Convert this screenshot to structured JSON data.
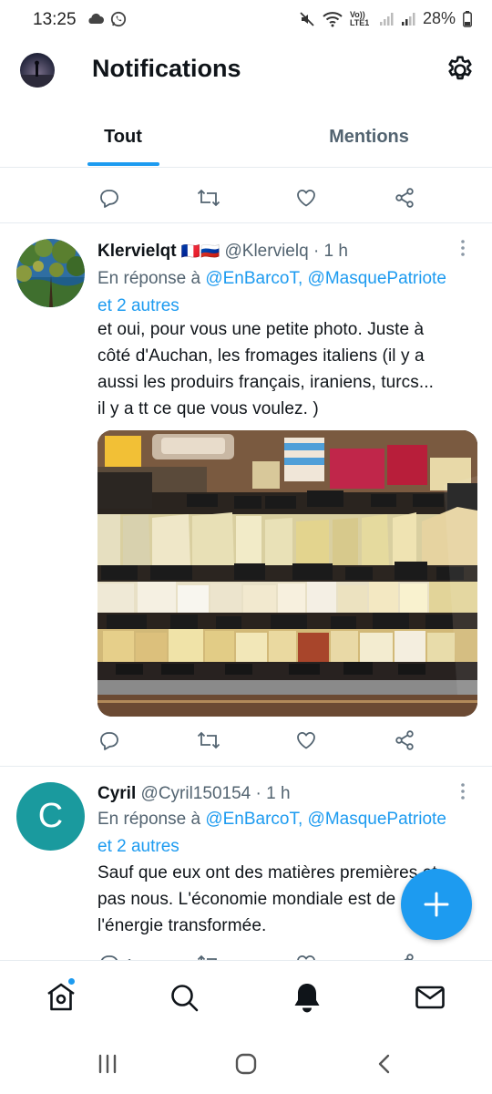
{
  "status_bar": {
    "time": "13:25",
    "network_label": "Vo)) LTE1",
    "battery": "28%",
    "icons": [
      "cloud-icon",
      "whatsapp-icon",
      "mute-icon",
      "wifi-icon",
      "signal-icon",
      "signal-icon",
      "battery-icon"
    ]
  },
  "header": {
    "title": "Notifications",
    "settings_icon": "gear-icon"
  },
  "tabs": [
    {
      "label": "Tout",
      "active": true
    },
    {
      "label": "Mentions",
      "active": false
    }
  ],
  "tweets": [
    {
      "name": "Klervielqt",
      "flags": "🇫🇷🇷🇺",
      "handle": "@Klervielq",
      "time": "· 1 h",
      "reply_prefix": "En réponse à",
      "reply_mentions": "@EnBarcoT, @MasquePatriote",
      "reply_suffix": "et 2 autres",
      "text_lines": [
        "et oui, pour vous une petite photo. Juste à",
        "côté d'Auchan, les fromages italiens (il y a",
        "aussi les produirs français, iraniens, turcs...",
        "il y a tt ce que vous voulez. )"
      ],
      "photo": "cheese-counter-photo"
    },
    {
      "name": "Cyril",
      "handle": "@Cyril150154",
      "time": "· 1 h",
      "avatar_letter": "C",
      "avatar_color": "#1a9a9e",
      "reply_prefix": "En réponse à",
      "reply_mentions": "@EnBarcoT, @MasquePatriote",
      "reply_suffix": "et 2 autres",
      "text_lines": [
        "Sauf que eux ont des matières premières et",
        "pas nous. L'économie mondiale est de",
        "l'énergie transformée."
      ],
      "reply_count": "1"
    }
  ],
  "colors": {
    "accent": "#1d9bf0",
    "text": "#0f1419",
    "muted": "#536471",
    "divider": "#e6ecf0"
  },
  "bottom_nav": [
    "home-icon",
    "search-icon",
    "bell-icon",
    "mail-icon"
  ],
  "system_nav": [
    "recents-icon",
    "home-circle-icon",
    "back-icon"
  ]
}
